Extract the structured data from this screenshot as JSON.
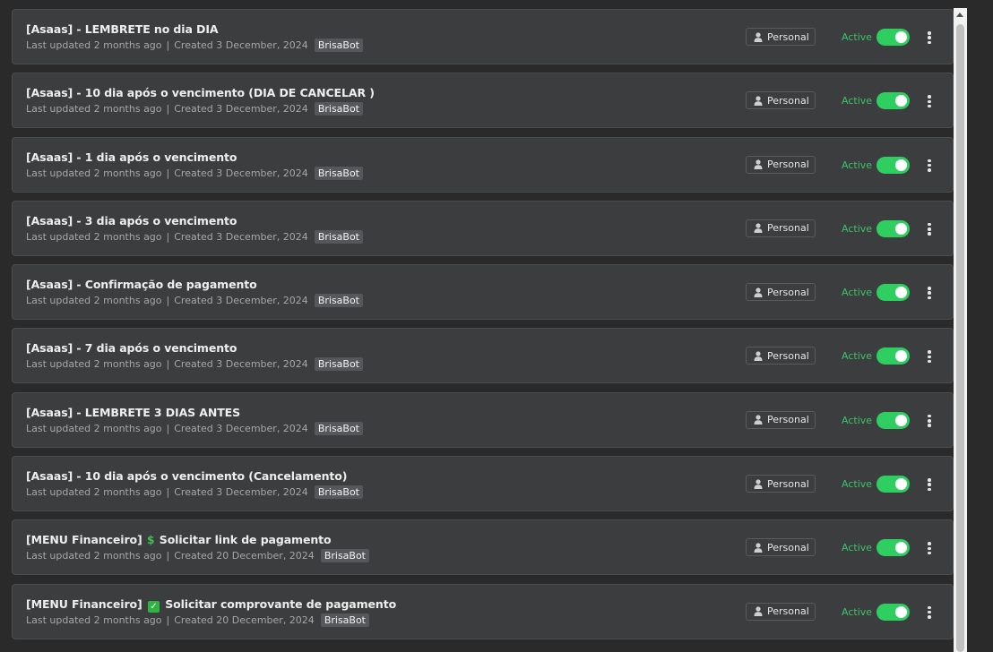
{
  "status_label": "Active",
  "visibility_label": "Personal",
  "items": [
    {
      "title": "[Asaas] - LEMBRETE no dia DIA",
      "updated": "Last updated 2 months ago",
      "created": "Created 3 December, 2024",
      "tag": "BrisaBot"
    },
    {
      "title": "[Asaas] - 10 dia após o vencimento (DIA DE CANCELAR )",
      "updated": "Last updated 2 months ago",
      "created": "Created 3 December, 2024",
      "tag": "BrisaBot"
    },
    {
      "title": "[Asaas] - 1 dia após o vencimento",
      "updated": "Last updated 2 months ago",
      "created": "Created 3 December, 2024",
      "tag": "BrisaBot"
    },
    {
      "title": "[Asaas] - 3 dia após o vencimento",
      "updated": "Last updated 2 months ago",
      "created": "Created 3 December, 2024",
      "tag": "BrisaBot"
    },
    {
      "title": "[Asaas] - Confirmação de pagamento",
      "updated": "Last updated 2 months ago",
      "created": "Created 3 December, 2024",
      "tag": "BrisaBot"
    },
    {
      "title": "[Asaas] - 7 dia após o vencimento",
      "updated": "Last updated 2 months ago",
      "created": "Created 3 December, 2024",
      "tag": "BrisaBot"
    },
    {
      "title": "[Asaas] - LEMBRETE 3 DIAS ANTES",
      "updated": "Last updated 2 months ago",
      "created": "Created 3 December, 2024",
      "tag": "BrisaBot"
    },
    {
      "title": "[Asaas] - 10 dia após o vencimento (Cancelamento)",
      "updated": "Last updated 2 months ago",
      "created": "Created 3 December, 2024",
      "tag": "BrisaBot"
    },
    {
      "title_prefix": "[MENU Financeiro]",
      "title_emoji": "$",
      "title_suffix": "Solicitar link de pagamento",
      "updated": "Last updated 2 months ago",
      "created": "Created 20 December, 2024",
      "tag": "BrisaBot"
    },
    {
      "title_prefix": "[MENU Financeiro]",
      "title_emoji": "✓",
      "title_suffix": "Solicitar comprovante de pagamento",
      "updated": "Last updated 2 months ago",
      "created": "Created 20 December, 2024",
      "tag": "BrisaBot"
    }
  ],
  "colors": {
    "active": "#3cc36a",
    "toggle_on": "#2fce61",
    "row_bg": "#3c3d3e",
    "page_bg": "#2a2a2b"
  }
}
